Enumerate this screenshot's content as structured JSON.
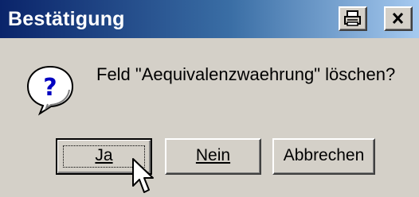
{
  "dialog": {
    "title": "Bestätigung",
    "message": "Feld \"Aequivalenzwaehrung\" löschen?",
    "buttons": {
      "yes": "Ja",
      "no": "Nein",
      "cancel": "Abbrechen"
    },
    "icon": "question-icon",
    "titlebar_icons": [
      "print-icon",
      "close-icon"
    ]
  }
}
